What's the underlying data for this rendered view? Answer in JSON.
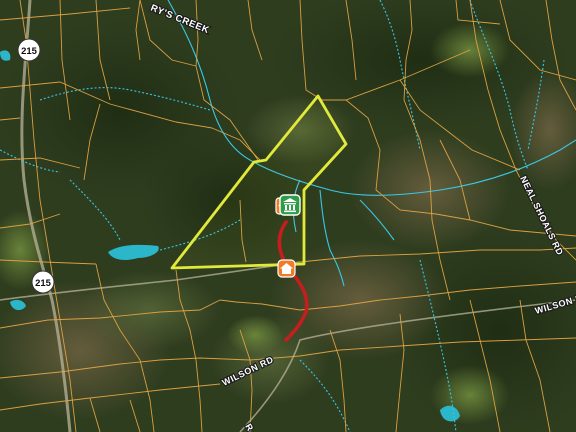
{
  "map": {
    "colors": {
      "parcel_lines": "#e3a443",
      "boundary": "#e1e93a",
      "streams": "#39c8e6",
      "route": "#c41e1e",
      "ponds": "#2bb6c9",
      "marker_orange": "#f07c2a",
      "marker_green": "#2e9d47"
    },
    "road_labels": {
      "creek": "RY'S CREEK",
      "neal_shoals": "NEAL SHOALS RD",
      "wilson_rd_left": "WILSON RD",
      "wilson_rd_right": "WILSON RD",
      "road_bottom": "R"
    },
    "shields": {
      "highway_top": "215",
      "highway_mid": "215"
    },
    "markers": [
      {
        "icon": "home-icon",
        "color": "orange"
      },
      {
        "icon": "bank-icon",
        "color": "green"
      },
      {
        "icon": "home-icon",
        "color": "orange"
      }
    ]
  }
}
